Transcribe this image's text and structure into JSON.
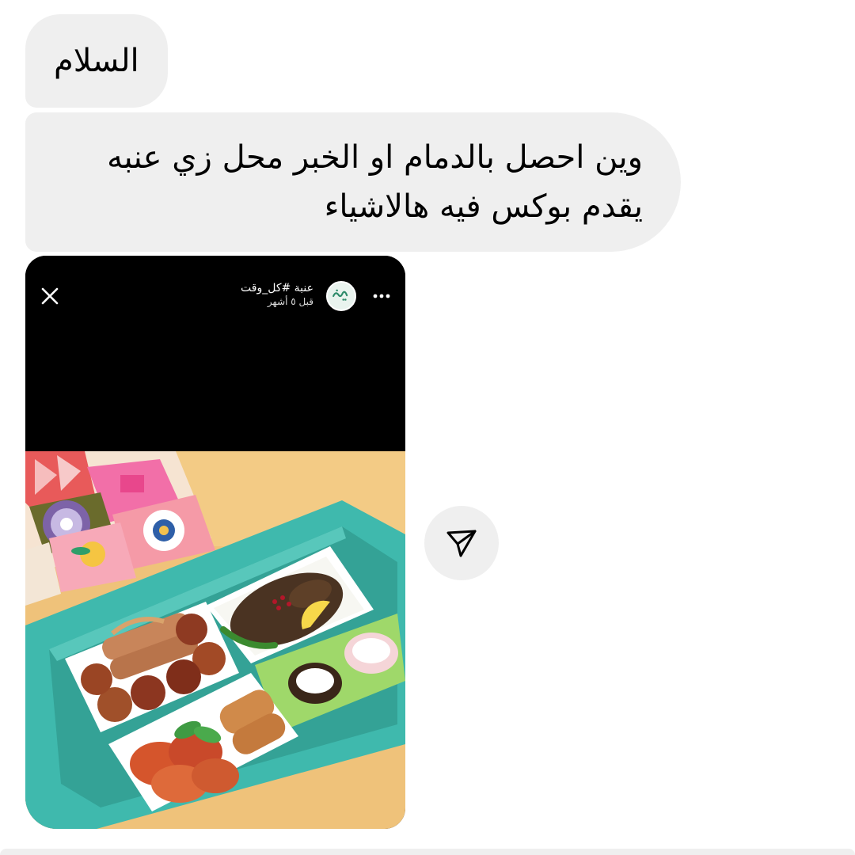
{
  "messages": [
    {
      "text": "السلام"
    },
    {
      "lines": [
        "وين احصل بالدمام او الخبر محل زي عنبه",
        "يقدم بوكس فيه هالاشياء"
      ]
    }
  ],
  "story": {
    "account_name": "عنبة #كل_وقت",
    "time_ago": "قبل ٥ أشهر",
    "avatar_logo_text": "عنبة",
    "close_icon": "close-icon",
    "more_icon": "more-horizontal-icon",
    "photo_subject": "food-box-photo"
  },
  "share": {
    "icon": "send-paper-plane-icon"
  },
  "colors": {
    "bubble_bg": "#efefef",
    "story_bg": "#000000",
    "box_teal": "#3fb9ad",
    "backdrop_orange": "#efc27a",
    "brand_green": "#2e8b6a"
  }
}
